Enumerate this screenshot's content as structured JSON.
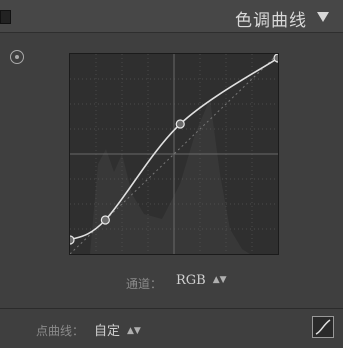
{
  "header": {
    "title": "色调曲线"
  },
  "curve": {
    "points": [
      {
        "input": 0,
        "output": 7
      },
      {
        "input": 17,
        "output": 17
      },
      {
        "input": 53,
        "output": 65
      },
      {
        "input": 100,
        "output": 98
      }
    ]
  },
  "channel": {
    "label": "通道：",
    "value": "RGB"
  },
  "point_curve": {
    "label": "点曲线：",
    "value": "自定"
  },
  "icons": {
    "target": "target-adjustment-icon",
    "collapse": "triangle-down-icon",
    "updown": "up-down-arrows-icon",
    "curve_toggle": "curve-edit-icon"
  }
}
